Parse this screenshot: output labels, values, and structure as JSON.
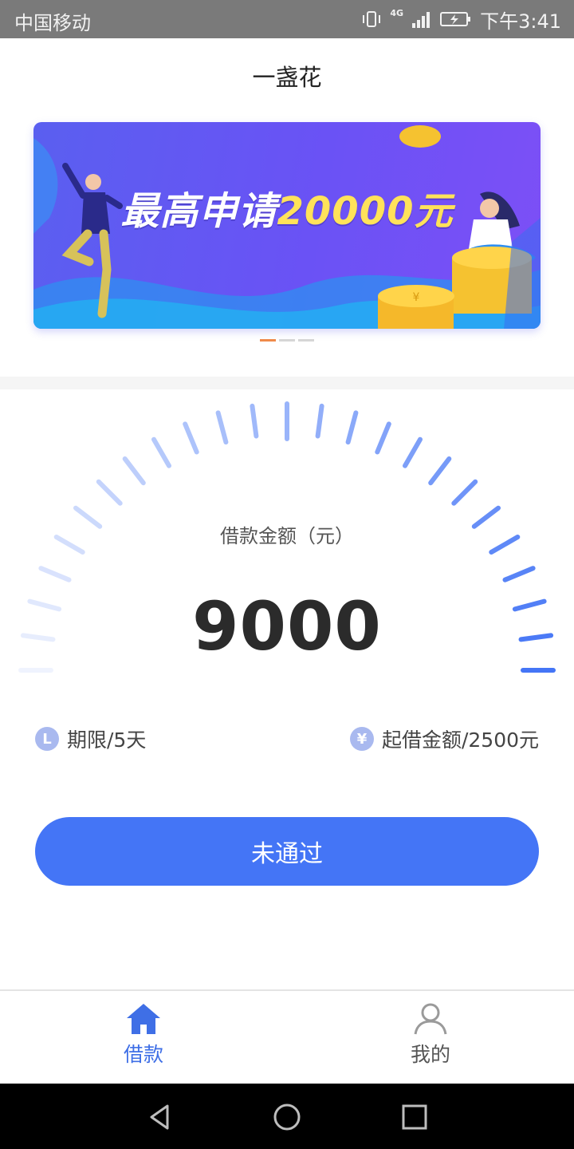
{
  "status_bar": {
    "carrier": "中国移动",
    "network": "4G",
    "time": "下午3:41"
  },
  "header": {
    "title": "一盏花"
  },
  "banner": {
    "text_prefix": "最高申请",
    "text_highlight": "20000元",
    "slide_count": 3,
    "active_slide": 1
  },
  "loan": {
    "amount_label": "借款金额（元）",
    "amount_value": "9000",
    "term_label": "期限/5天",
    "min_amount_label": "起借金额/2500元",
    "term_icon": "L",
    "min_amount_icon": "¥",
    "submit_label": "未通过"
  },
  "tabs": [
    {
      "label": "借款",
      "icon": "home-icon",
      "active": true
    },
    {
      "label": "我的",
      "icon": "user-icon",
      "active": false
    }
  ],
  "colors": {
    "primary": "#4475f6",
    "tab_active": "#3f6fe6",
    "banner_start": "#5a5ff0",
    "banner_end": "#7d4ff6",
    "highlight_yellow": "#ffe25a",
    "indicator_active": "#ef8a4a"
  }
}
